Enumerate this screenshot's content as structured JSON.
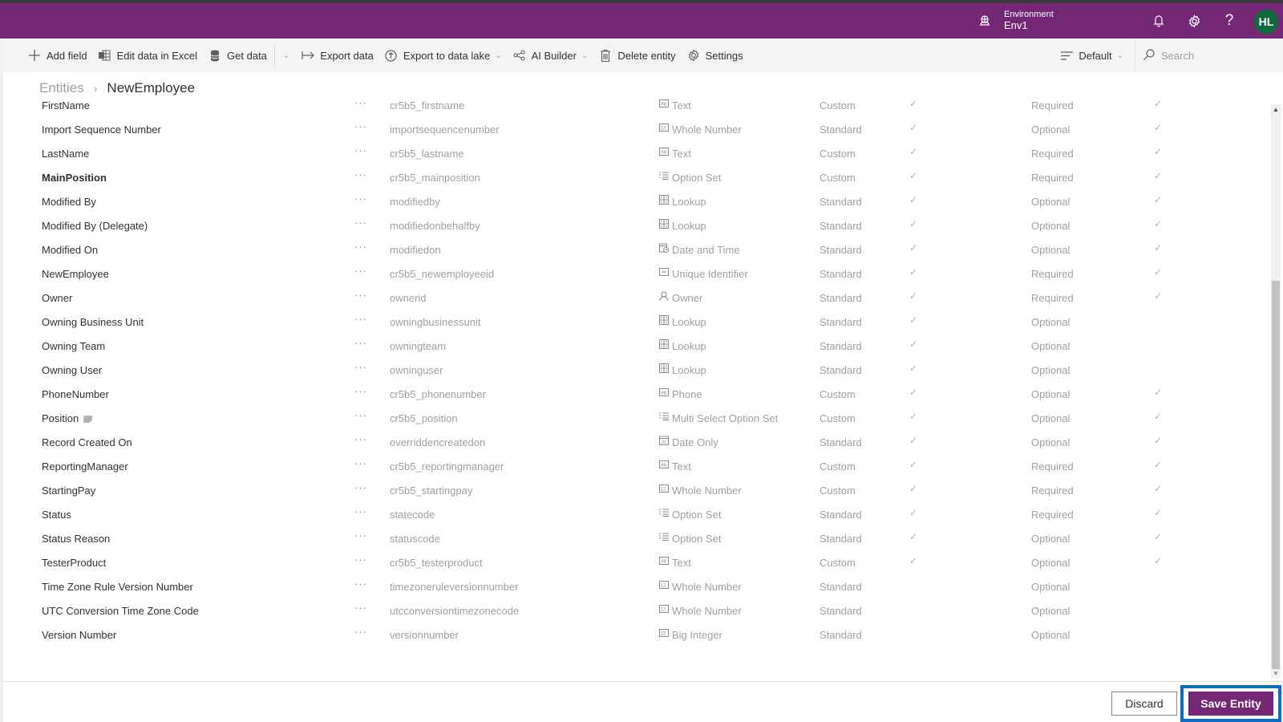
{
  "topbar": {
    "environment_label": "Environment",
    "environment_value": "Env1",
    "avatar_initials": "HL",
    "brand_color": "#742774"
  },
  "commandbar": {
    "add_field": "Add field",
    "edit_excel": "Edit data in Excel",
    "get_data": "Get data",
    "export_data": "Export data",
    "export_lake": "Export to data lake",
    "ai_builder": "AI Builder",
    "delete_entity": "Delete entity",
    "settings": "Settings",
    "view_selector": "Default",
    "search_placeholder": "Search"
  },
  "breadcrumb": {
    "root": "Entities",
    "current": "NewEmployee"
  },
  "fields": [
    {
      "name": "FirstName",
      "system": "cr5b5_firstname",
      "type": "Text",
      "type_icon": "text-icon",
      "kind": "Custom",
      "searchable": true,
      "requirement": "Required",
      "customizable": true
    },
    {
      "name": "Import Sequence Number",
      "system": "importsequencenumber",
      "type": "Whole Number",
      "type_icon": "number-icon",
      "kind": "Standard",
      "searchable": true,
      "requirement": "Optional",
      "customizable": true
    },
    {
      "name": "LastName",
      "system": "cr5b5_lastname",
      "type": "Text",
      "type_icon": "text-icon",
      "kind": "Custom",
      "searchable": true,
      "requirement": "Required",
      "customizable": true
    },
    {
      "name": "MainPosition",
      "system": "cr5b5_mainposition",
      "type": "Option Set",
      "type_icon": "option-set-icon",
      "kind": "Custom",
      "searchable": true,
      "requirement": "Required",
      "customizable": true,
      "bold": true
    },
    {
      "name": "Modified By",
      "system": "modifiedby",
      "type": "Lookup",
      "type_icon": "lookup-icon",
      "kind": "Standard",
      "searchable": true,
      "requirement": "Optional",
      "customizable": true
    },
    {
      "name": "Modified By (Delegate)",
      "system": "modifiedonbehalfby",
      "type": "Lookup",
      "type_icon": "lookup-icon",
      "kind": "Standard",
      "searchable": true,
      "requirement": "Optional",
      "customizable": true
    },
    {
      "name": "Modified On",
      "system": "modifiedon",
      "type": "Date and Time",
      "type_icon": "date-time-icon",
      "kind": "Standard",
      "searchable": true,
      "requirement": "Optional",
      "customizable": true
    },
    {
      "name": "NewEmployee",
      "system": "cr5b5_newemployeeid",
      "type": "Unique Identifier",
      "type_icon": "unique-id-icon",
      "kind": "Standard",
      "searchable": true,
      "requirement": "Required",
      "customizable": true
    },
    {
      "name": "Owner",
      "system": "ownerid",
      "type": "Owner",
      "type_icon": "owner-icon",
      "kind": "Standard",
      "searchable": true,
      "requirement": "Required",
      "customizable": true
    },
    {
      "name": "Owning Business Unit",
      "system": "owningbusinessunit",
      "type": "Lookup",
      "type_icon": "lookup-icon",
      "kind": "Standard",
      "searchable": true,
      "requirement": "Optional",
      "customizable": false
    },
    {
      "name": "Owning Team",
      "system": "owningteam",
      "type": "Lookup",
      "type_icon": "lookup-icon",
      "kind": "Standard",
      "searchable": true,
      "requirement": "Optional",
      "customizable": false
    },
    {
      "name": "Owning User",
      "system": "owninguser",
      "type": "Lookup",
      "type_icon": "lookup-icon",
      "kind": "Standard",
      "searchable": true,
      "requirement": "Optional",
      "customizable": false
    },
    {
      "name": "PhoneNumber",
      "system": "cr5b5_phonenumber",
      "type": "Phone",
      "type_icon": "text-icon",
      "kind": "Custom",
      "searchable": true,
      "requirement": "Optional",
      "customizable": true
    },
    {
      "name": "Position",
      "system": "cr5b5_position",
      "type": "Multi Select Option Set",
      "type_icon": "option-set-icon",
      "kind": "Custom",
      "searchable": true,
      "requirement": "Optional",
      "customizable": true,
      "tag": true
    },
    {
      "name": "Record Created On",
      "system": "overriddencreatedon",
      "type": "Date Only",
      "type_icon": "date-only-icon",
      "kind": "Standard",
      "searchable": true,
      "requirement": "Optional",
      "customizable": true
    },
    {
      "name": "ReportingManager",
      "system": "cr5b5_reportingmanager",
      "type": "Text",
      "type_icon": "text-icon",
      "kind": "Custom",
      "searchable": true,
      "requirement": "Required",
      "customizable": true
    },
    {
      "name": "StartingPay",
      "system": "cr5b5_startingpay",
      "type": "Whole Number",
      "type_icon": "number-icon",
      "kind": "Custom",
      "searchable": true,
      "requirement": "Required",
      "customizable": true
    },
    {
      "name": "Status",
      "system": "statecode",
      "type": "Option Set",
      "type_icon": "option-set-icon",
      "kind": "Standard",
      "searchable": true,
      "requirement": "Required",
      "customizable": true
    },
    {
      "name": "Status Reason",
      "system": "statuscode",
      "type": "Option Set",
      "type_icon": "option-set-icon",
      "kind": "Standard",
      "searchable": true,
      "requirement": "Optional",
      "customizable": true
    },
    {
      "name": "TesterProduct",
      "system": "cr5b5_testerproduct",
      "type": "Text",
      "type_icon": "text-icon",
      "kind": "Custom",
      "searchable": true,
      "requirement": "Optional",
      "customizable": true
    },
    {
      "name": "Time Zone Rule Version Number",
      "system": "timezoneruleversionnumber",
      "type": "Whole Number",
      "type_icon": "number-icon",
      "kind": "Standard",
      "searchable": false,
      "requirement": "Optional",
      "customizable": false
    },
    {
      "name": "UTC Conversion Time Zone Code",
      "system": "utcconversiontimezonecode",
      "type": "Whole Number",
      "type_icon": "number-icon",
      "kind": "Standard",
      "searchable": false,
      "requirement": "Optional",
      "customizable": false
    },
    {
      "name": "Version Number",
      "system": "versionnumber",
      "type": "Big Integer",
      "type_icon": "number-icon",
      "kind": "Standard",
      "searchable": false,
      "requirement": "Optional",
      "customizable": false
    }
  ],
  "row_more_label": "···",
  "check_glyph": "✓",
  "footer": {
    "discard": "Discard",
    "save": "Save Entity"
  }
}
